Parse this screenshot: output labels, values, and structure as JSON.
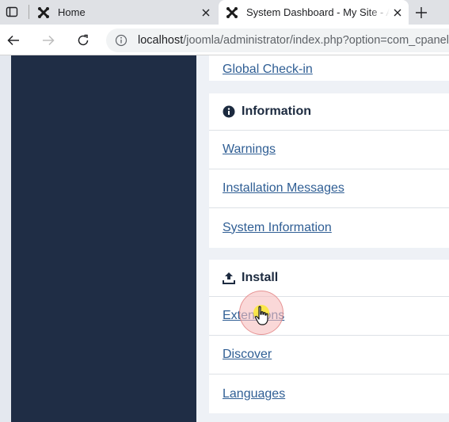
{
  "browser": {
    "tabs": [
      {
        "title": "Home",
        "active": false
      },
      {
        "title": "System Dashboard - My Site - Administration",
        "active": true
      }
    ],
    "url": {
      "host": "localhost",
      "path": "/joomla/administrator/index.php?option=com_cpanel&view=system"
    }
  },
  "page": {
    "top_card": {
      "link": "Global Check-in"
    },
    "information": {
      "title": "Information",
      "icon": "info-circle-icon",
      "items": [
        "Warnings",
        "Installation Messages",
        "System Information"
      ]
    },
    "install": {
      "title": "Install",
      "icon": "upload-icon",
      "items": [
        "Extensions",
        "Discover",
        "Languages"
      ]
    }
  },
  "colors": {
    "sidebar": "#1f2d45",
    "link": "#2f5e94",
    "heading": "#1c2a3f",
    "background": "#eef1f6"
  }
}
